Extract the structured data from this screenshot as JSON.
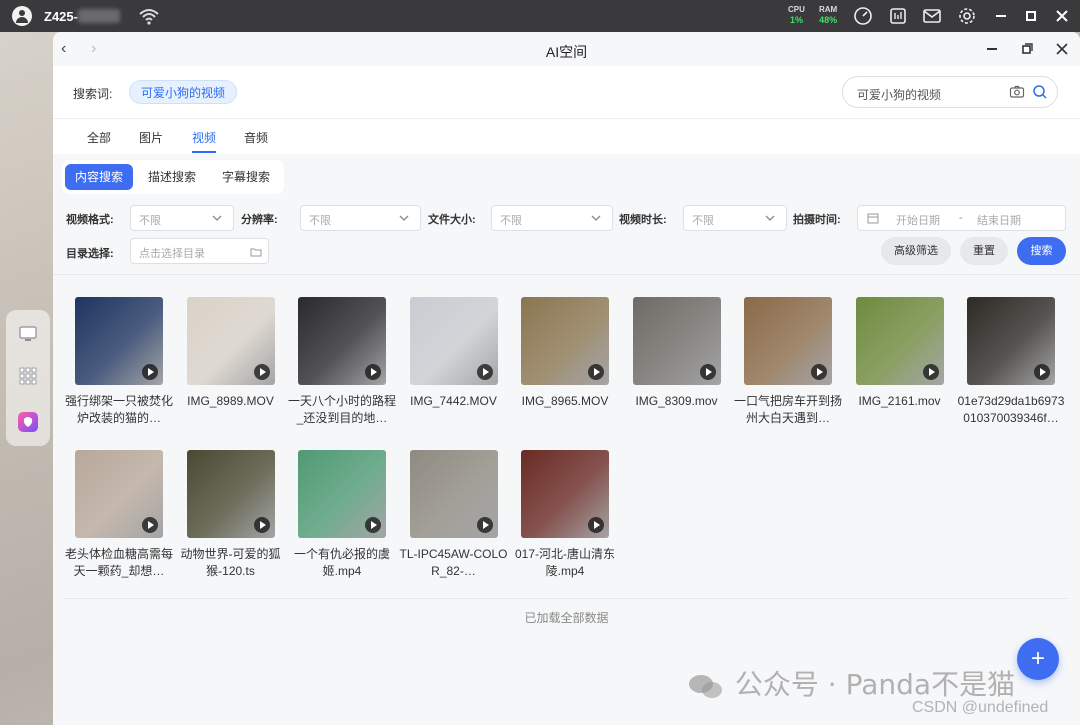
{
  "topbar": {
    "device_name": "Z425-",
    "cpu_label": "CPU",
    "cpu_value": "1%",
    "ram_label": "RAM",
    "ram_value": "48%"
  },
  "window": {
    "title": "AI空间"
  },
  "search": {
    "keyword_label": "搜索词:",
    "keyword_chip": "可爱小狗的视频",
    "input_value": "可爱小狗的视频"
  },
  "tabs": [
    {
      "label": "全部",
      "active": false
    },
    {
      "label": "图片",
      "active": false
    },
    {
      "label": "视频",
      "active": true
    },
    {
      "label": "音频",
      "active": false
    }
  ],
  "search_modes": [
    {
      "label": "内容搜索",
      "active": true
    },
    {
      "label": "描述搜索",
      "active": false
    },
    {
      "label": "字幕搜索",
      "active": false
    }
  ],
  "filters": {
    "format_label": "视频格式:",
    "format_value": "不限",
    "resolution_label": "分辨率:",
    "resolution_value": "不限",
    "size_label": "文件大小:",
    "size_value": "不限",
    "duration_label": "视频时长:",
    "duration_value": "不限",
    "shoot_time_label": "拍摄时间:",
    "start_date_placeholder": "开始日期",
    "date_separator": "-",
    "end_date_placeholder": "结束日期",
    "dir_label": "目录选择:",
    "dir_placeholder": "点击选择目录",
    "advanced_button": "高级筛选",
    "reset_button": "重置",
    "search_button": "搜索"
  },
  "results": [
    {
      "name": "强行绑架一只被焚化炉改装的猫的…",
      "thumb_color": "#1f3560"
    },
    {
      "name": "IMG_8989.MOV",
      "thumb_color": "#d9d2c8"
    },
    {
      "name": "一天八个小时的路程_还没到目的地…",
      "thumb_color": "#2a2a2e"
    },
    {
      "name": "IMG_7442.MOV",
      "thumb_color": "#c9ccd0"
    },
    {
      "name": "IMG_8965.MOV",
      "thumb_color": "#8a7550"
    },
    {
      "name": "IMG_8309.mov",
      "thumb_color": "#6e6b66"
    },
    {
      "name": "一口气把房车开到扬州大白天遇到…",
      "thumb_color": "#8a6a48"
    },
    {
      "name": "IMG_2161.mov",
      "thumb_color": "#6f8a3e"
    },
    {
      "name": "01e73d29da1b6973010370039346f…",
      "thumb_color": "#2e2a26"
    },
    {
      "name": "老头体检血糖高需每天一颗药_却想…",
      "thumb_color": "#b8a89a"
    },
    {
      "name": "动物世界-可爱的狐猴-120.ts",
      "thumb_color": "#4a4a32"
    },
    {
      "name": "一个有仇必报的虞姬.mp4",
      "thumb_color": "#4f9a74"
    },
    {
      "name": "TL-IPC45AW-COLOR_82-…",
      "thumb_color": "#8e8a80"
    },
    {
      "name": "017-河北-唐山清东陵.mp4",
      "thumb_color": "#6a2a24"
    }
  ],
  "footer": {
    "loaded_text": "已加载全部数据",
    "fab_label": "+"
  },
  "watermark": {
    "text": "公众号 · Panda不是猫",
    "csdn": "CSDN @undefined"
  }
}
